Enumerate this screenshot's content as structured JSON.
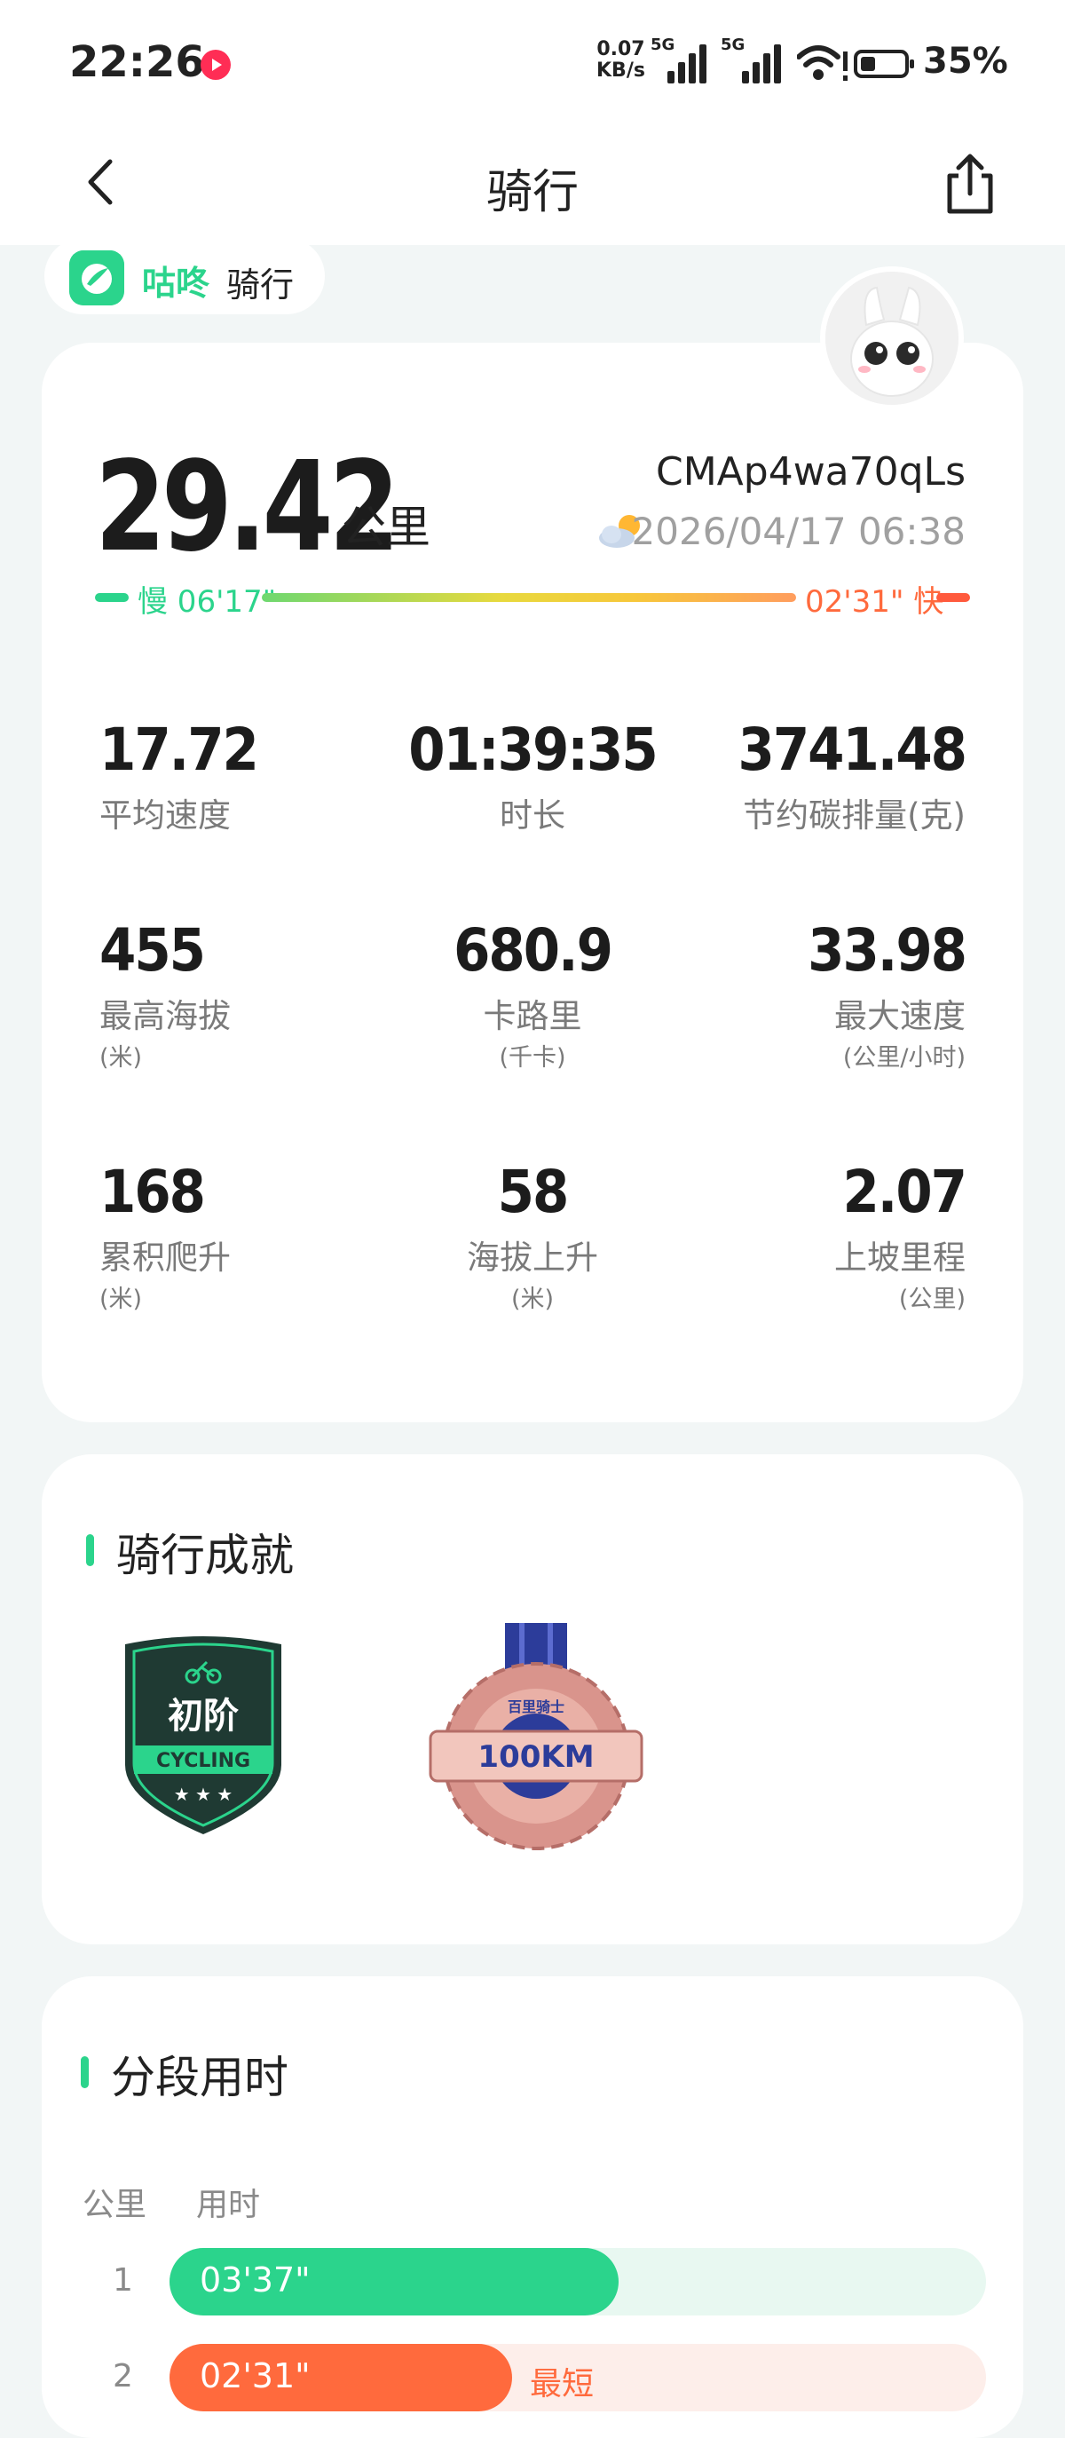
{
  "status_bar": {
    "time": "22:26",
    "net_speed_value": "0.07",
    "net_speed_unit": "KB/s",
    "sim1": "5G",
    "sim2": "5G",
    "battery": "35%"
  },
  "nav": {
    "title": "骑行"
  },
  "brand": {
    "name": "咕咚",
    "sub": "骑行"
  },
  "summary": {
    "distance": "29.42",
    "distance_unit": "公里",
    "ride_id": "CMAp4wa70qLs",
    "datetime": "2026/04/17 06:38",
    "pace_slow": "慢 06'17\"",
    "pace_fast": "02'31\" 快"
  },
  "stats": [
    {
      "value": "17.72",
      "label": "平均速度",
      "unit": ""
    },
    {
      "value": "01:39:35",
      "label": "时长",
      "unit": ""
    },
    {
      "value": "3741.48",
      "label": "节约碳排量(克)",
      "unit": ""
    },
    {
      "value": "455",
      "label": "最高海拔",
      "unit": "(米)"
    },
    {
      "value": "680.9",
      "label": "卡路里",
      "unit": "(千卡)"
    },
    {
      "value": "33.98",
      "label": "最大速度",
      "unit": "(公里/小时)"
    },
    {
      "value": "168",
      "label": "累积爬升",
      "unit": "(米)"
    },
    {
      "value": "58",
      "label": "海拔上升",
      "unit": "(米)"
    },
    {
      "value": "2.07",
      "label": "上坡里程",
      "unit": "(公里)"
    }
  ],
  "achievements": {
    "title": "骑行成就",
    "badge1": {
      "line1": "初阶",
      "line2": "CYCLING",
      "stars": "★ ★ ★"
    },
    "badge2": {
      "text": "100KM",
      "top": "百里骑士"
    }
  },
  "splits": {
    "title": "分段用时",
    "col_km": "公里",
    "col_time": "用时",
    "rows": [
      {
        "km": "1",
        "time": "03'37\"",
        "fraction": 0.55,
        "tag": ""
      },
      {
        "km": "2",
        "time": "02'31\"",
        "fraction": 0.42,
        "tag": "最短"
      }
    ],
    "colors": {
      "normal": "#2bd48c",
      "fastest": "#ff6a3d"
    }
  }
}
